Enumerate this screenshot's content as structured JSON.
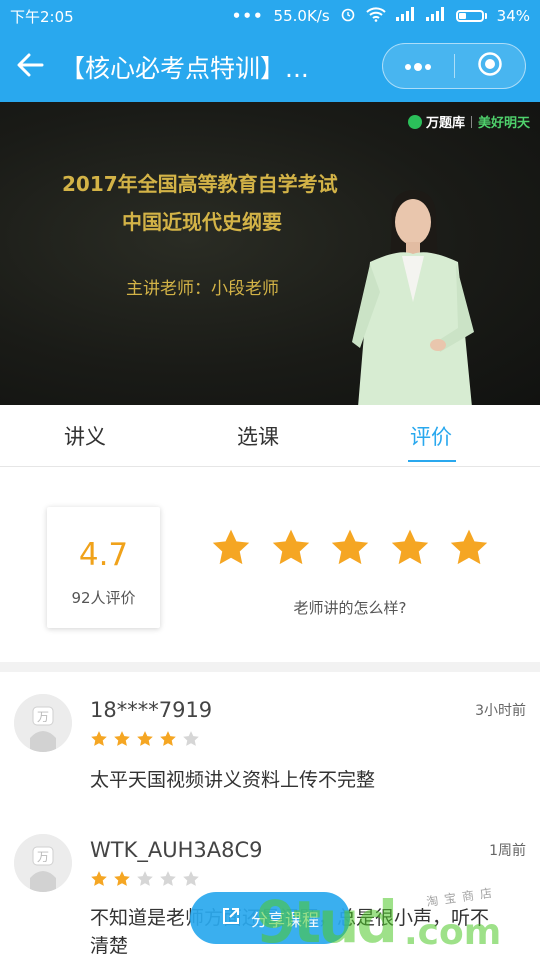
{
  "status_bar": {
    "time": "下午2:05",
    "network_speed": "55.0K/s",
    "battery": "34%",
    "battery_level": 0.34
  },
  "navbar": {
    "title": "【核心必考点特训】...",
    "back_icon": "arrow-left-icon",
    "more_icon": "more-dots-icon",
    "close_icon": "target-circle-icon"
  },
  "video": {
    "brand_primary": "万题库",
    "brand_secondary": "美好明天",
    "title_line1": "2017年全国高等教育自学考试",
    "title_line2": "中国近现代史纲要",
    "teacher_line": "主讲老师：小段老师"
  },
  "tabs": [
    {
      "label": "讲义",
      "active": false
    },
    {
      "label": "选课",
      "active": false
    },
    {
      "label": "评价",
      "active": true
    }
  ],
  "rating": {
    "score": "4.7",
    "count_text": "92人评价",
    "stars_total": 5,
    "prompt": "老师讲的怎么样?"
  },
  "reviews": [
    {
      "user": "18****7919",
      "time": "3小时前",
      "stars": 4,
      "text": "太平天国视频讲义资料上传不完整"
    },
    {
      "user": "WTK_AUH3A8C9",
      "time": "1周前",
      "stars": 2,
      "text": "不知道是老师方面还是问题，总是很小声，听不清楚"
    }
  ],
  "share_button": {
    "label": "分享课程",
    "icon": "share-icon"
  },
  "colors": {
    "accent": "#29a8ee",
    "star": "#f5a623",
    "star_empty": "#d6d6d6",
    "score": "#f0a21a"
  },
  "watermark": {
    "main": "9tud",
    "suffix": ".com",
    "sub": "淘宝商店"
  }
}
